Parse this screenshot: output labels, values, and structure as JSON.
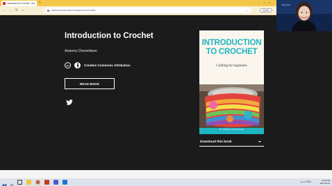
{
  "browser": {
    "tab_title": "Introduction to Crochet - Sim...",
    "tab_close": "×",
    "new_tab": "+",
    "url": "https://pressbooks.bccampus.ca/crochet/",
    "update_label": "Update",
    "menu": "⋮",
    "nav": {
      "back": "←",
      "forward": "→",
      "reload": "↻",
      "home": "⌂"
    },
    "window_controls": "–□×"
  },
  "book": {
    "title": "Introduction to Crochet",
    "author": "Arianna Cheveldave",
    "license_cc": "cc",
    "license_text": "Creative Commons Attribution",
    "read_button": "READ BOOK",
    "download_label": "Download this book"
  },
  "cover": {
    "title_line1": "INTRODUCTION",
    "title_line2": "TO CROCHET",
    "subtitle": "Crafting for beginners",
    "author": "BY ARIANNA CHEVELDAVE",
    "accent_color": "#1fb5c3"
  },
  "taskbar": {
    "time": "10:51 AM",
    "date": "2022-06-22",
    "tray": "^ ☁ ⊡ ENG"
  },
  "webcam": {
    "label": "BCcampus"
  },
  "icons": [
    "windows-start-icon",
    "search-icon",
    "task-view-icon",
    "file-explorer-icon",
    "chrome-icon",
    "teams-icon",
    "twitter-icon",
    "lock-icon",
    "star-icon"
  ]
}
